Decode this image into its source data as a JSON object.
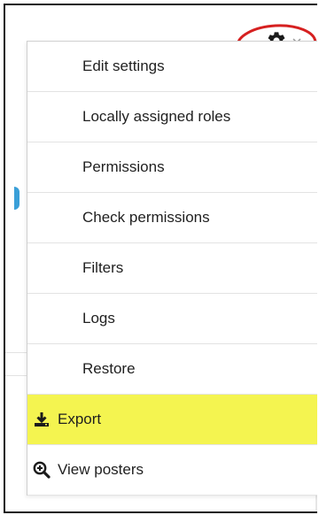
{
  "menu": {
    "items": [
      {
        "label": "Edit settings"
      },
      {
        "label": "Locally assigned roles"
      },
      {
        "label": "Permissions"
      },
      {
        "label": "Check permissions"
      },
      {
        "label": "Filters"
      },
      {
        "label": "Logs"
      },
      {
        "label": "Restore"
      },
      {
        "label": "Export"
      },
      {
        "label": "View posters"
      }
    ]
  },
  "icons": {
    "gear": "gear-icon",
    "dropdown": "caret-down-icon",
    "export": "download-icon",
    "view_posters": "zoom-in-icon"
  },
  "colors": {
    "highlight": "#f4f450",
    "annotation": "#d62020",
    "accent": "#3a9fd8"
  }
}
